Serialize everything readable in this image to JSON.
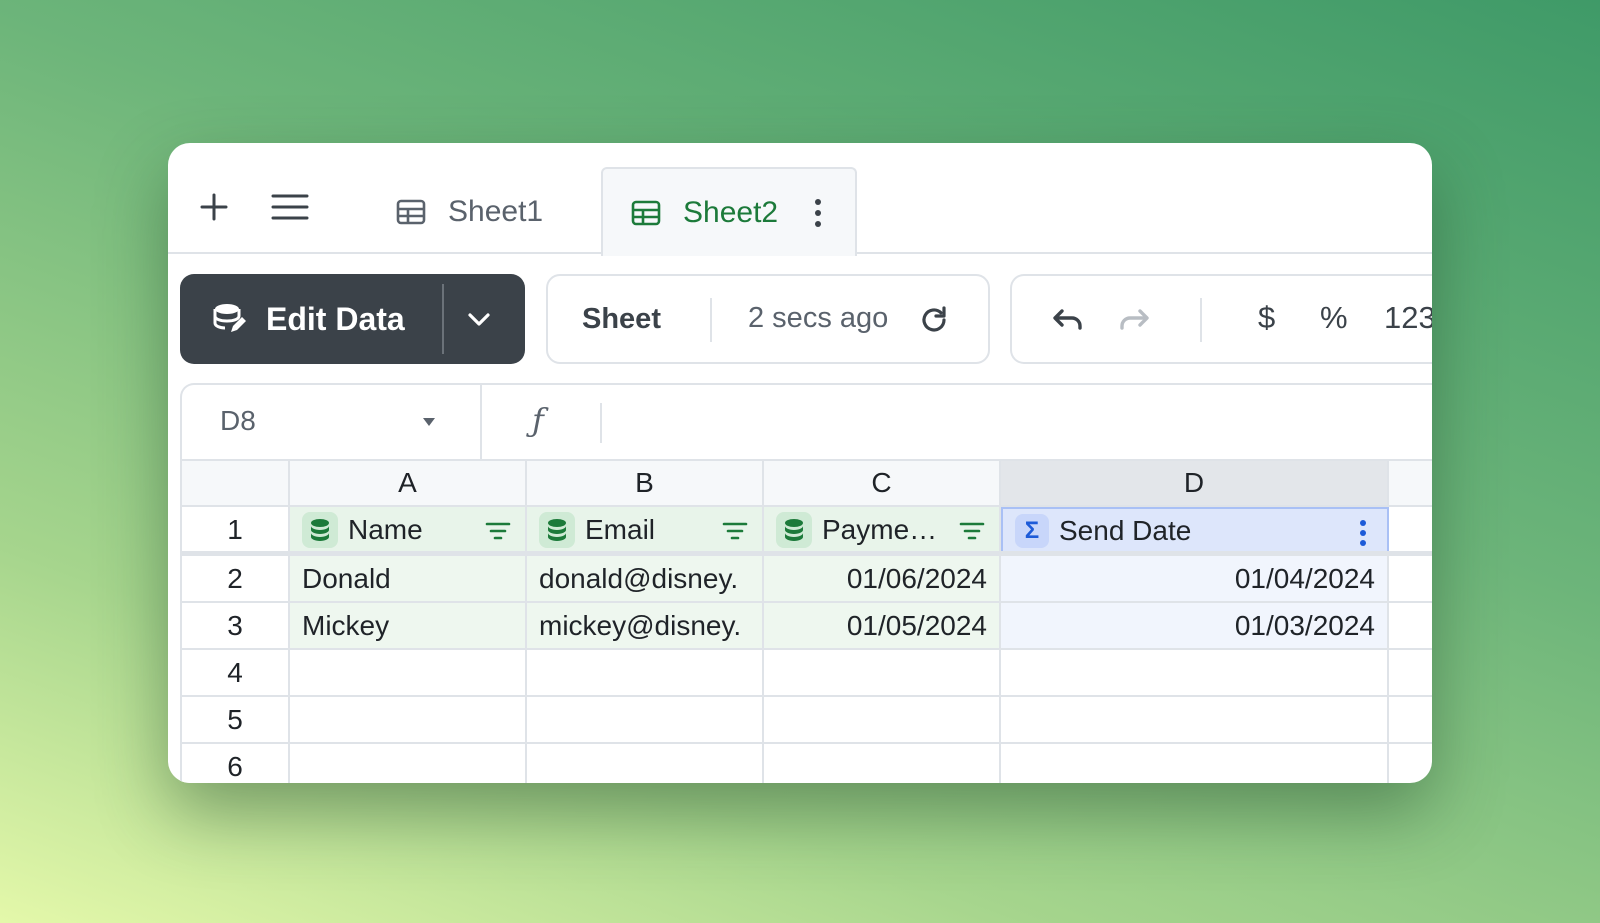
{
  "tabs": [
    {
      "label": "Sheet1",
      "active": false
    },
    {
      "label": "Sheet2",
      "active": true
    }
  ],
  "toolbar": {
    "edit_label": "Edit Data",
    "sheet_label": "Sheet",
    "sync_time": "2 secs ago",
    "currency": "$",
    "percent": "%",
    "number_format": "123"
  },
  "formula_bar": {
    "cell_ref": "D8",
    "fx_symbol": "ƒ",
    "formula": ""
  },
  "grid": {
    "columns": [
      "A",
      "B",
      "C",
      "D"
    ],
    "selected_column": "D",
    "rows": [
      "1",
      "2",
      "3",
      "4",
      "5",
      "6"
    ],
    "headers": [
      {
        "label": "Name",
        "icon": "database-icon"
      },
      {
        "label": "Email",
        "icon": "database-icon"
      },
      {
        "label": "Payme…",
        "icon": "database-icon"
      },
      {
        "label": "Send Date",
        "icon": "sigma-icon"
      }
    ],
    "data": [
      [
        "Donald",
        "donald@disney.",
        "01/06/2024",
        "01/04/2024"
      ],
      [
        "Mickey",
        "mickey@disney.",
        "01/05/2024",
        "01/03/2024"
      ]
    ]
  },
  "colors": {
    "accent_green": "#1c7a3a",
    "dark_button": "#3b4249",
    "sum_blue": "#1d5bd8"
  }
}
